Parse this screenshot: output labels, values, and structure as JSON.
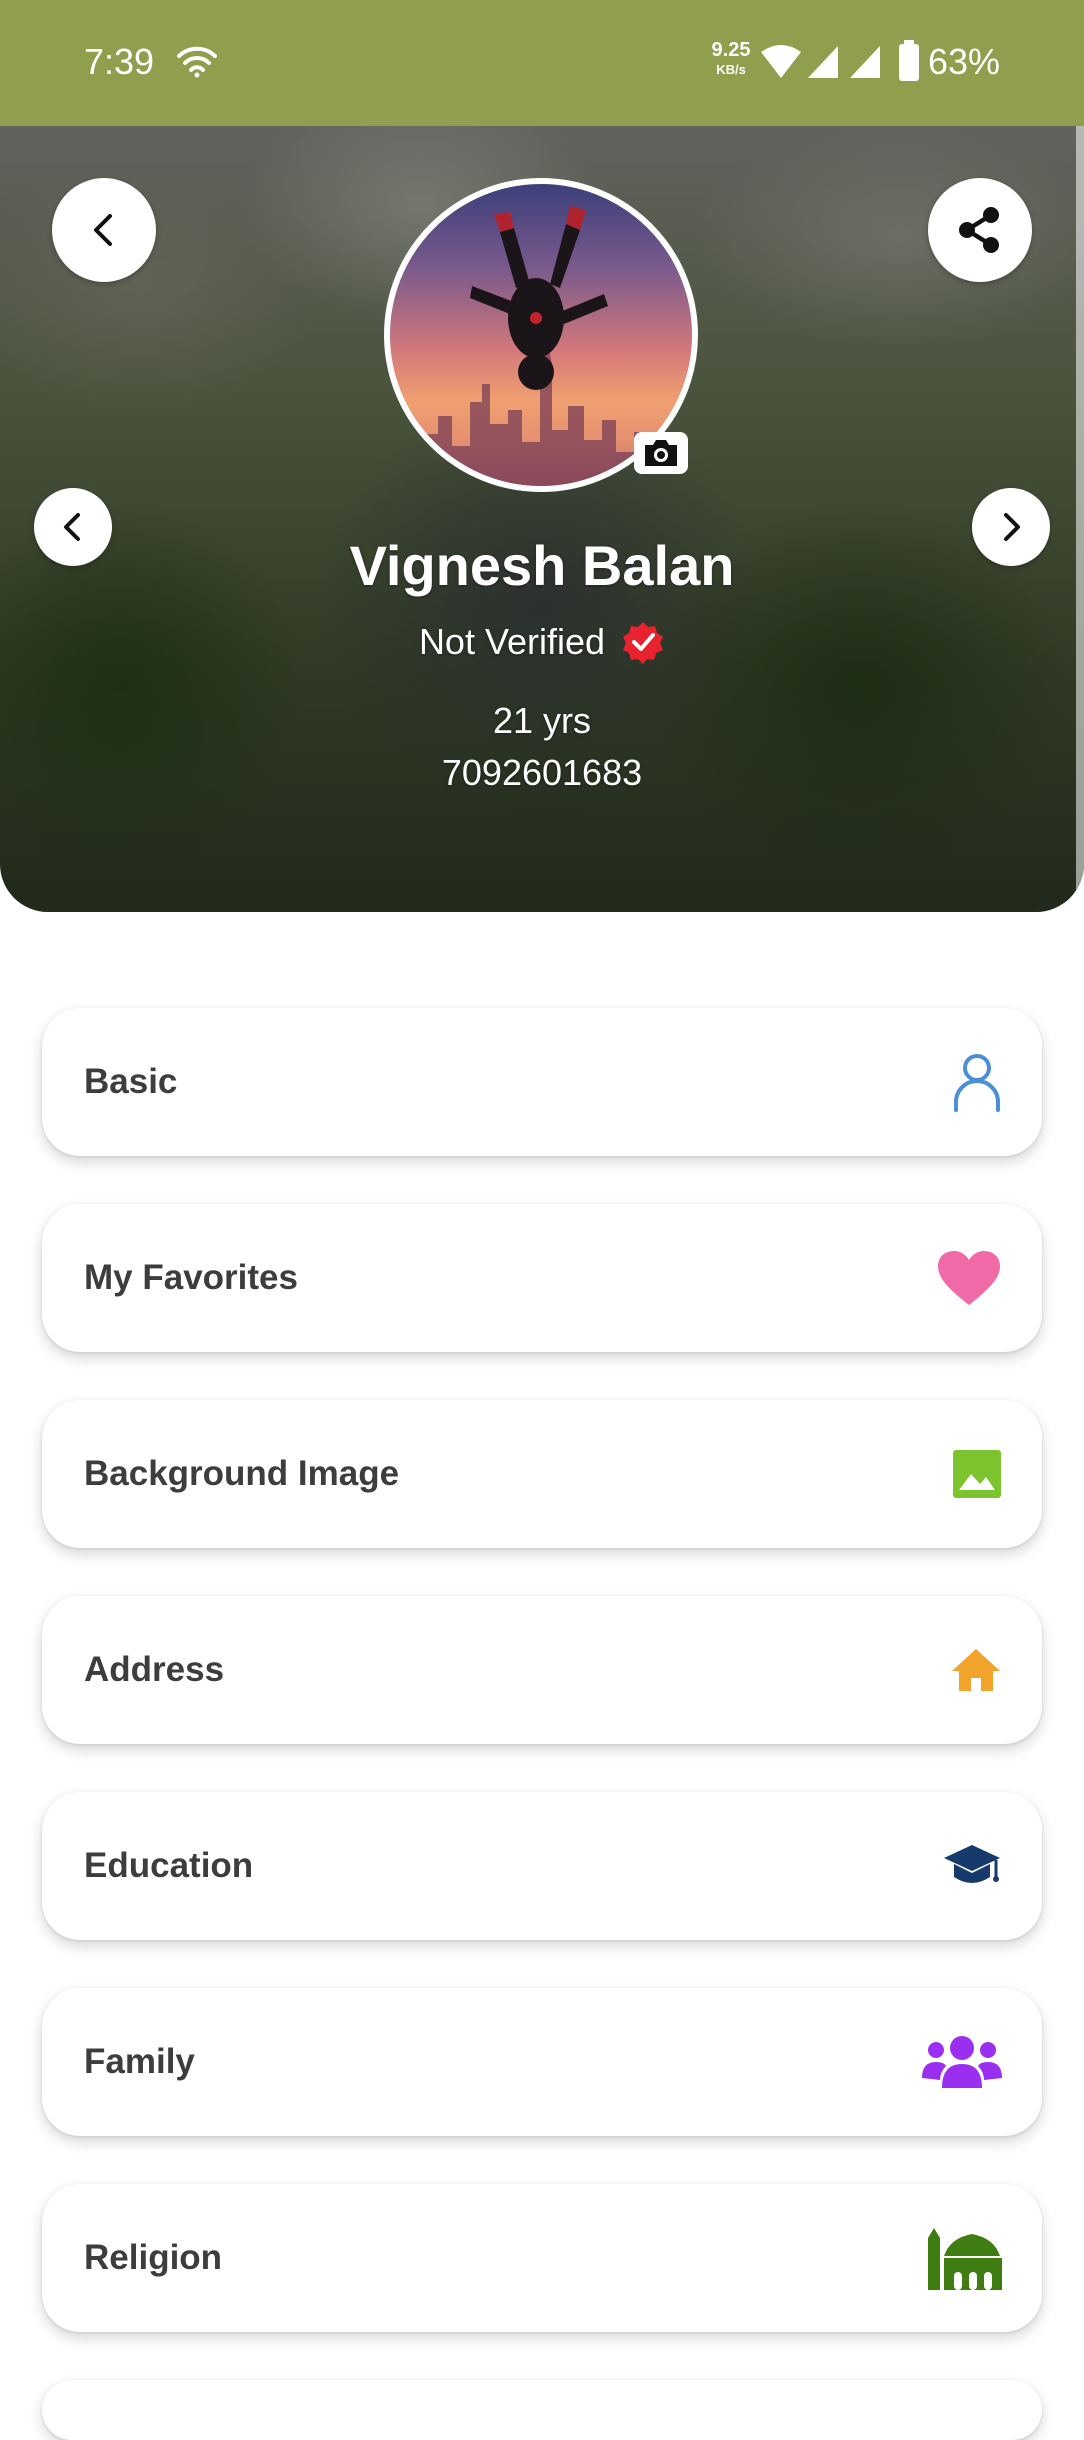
{
  "status_bar": {
    "time": "7:39",
    "net_rate": "9.25",
    "net_unit": "KB/s",
    "battery_pct": "63%",
    "background": "#8f9f4d"
  },
  "header": {
    "icons": {
      "back": "chevron-left-icon",
      "share": "share-icon",
      "prev": "chevron-left-icon",
      "next": "chevron-right-icon",
      "camera": "camera-icon",
      "verified": "verified-badge-icon"
    }
  },
  "profile": {
    "name": "Vignesh Balan",
    "verification_status": "Not Verified",
    "age": "21 yrs",
    "phone": "7092601683"
  },
  "menu": {
    "items": [
      {
        "label": "Basic",
        "icon": "person-icon",
        "color": "#4a8fd8"
      },
      {
        "label": "My Favorites",
        "icon": "heart-icon",
        "color": "#f06aa8"
      },
      {
        "label": "Background Image",
        "icon": "image-icon",
        "color": "#7cc32e"
      },
      {
        "label": "Address",
        "icon": "home-icon",
        "color": "#f1a32c"
      },
      {
        "label": "Education",
        "icon": "graduation-cap-icon",
        "color": "#153a6b"
      },
      {
        "label": "Family",
        "icon": "family-icon",
        "color": "#9b2ff0"
      },
      {
        "label": "Religion",
        "icon": "mosque-icon",
        "color": "#3f7d12"
      }
    ]
  }
}
